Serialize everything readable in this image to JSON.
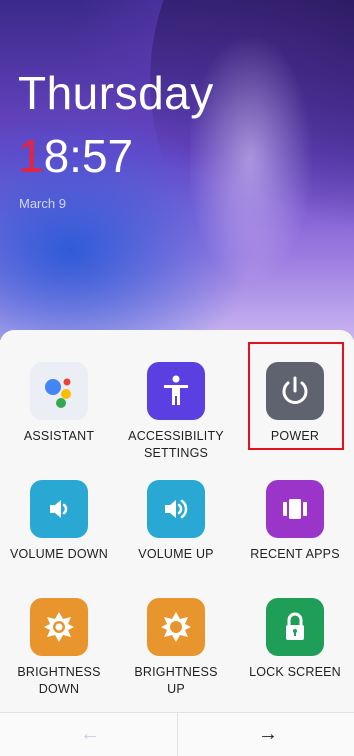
{
  "lockscreen": {
    "day": "Thursday",
    "time_first_digit": "1",
    "time_rest": "8:57",
    "date": "March 9"
  },
  "menu": {
    "items": [
      {
        "label": "ASSISTANT",
        "icon": "google-assistant-icon"
      },
      {
        "label": "ACCESSIBILITY\nSETTINGS",
        "icon": "accessibility-person-icon"
      },
      {
        "label": "POWER",
        "icon": "power-icon"
      },
      {
        "label": "VOLUME DOWN",
        "icon": "volume-down-icon"
      },
      {
        "label": "VOLUME UP",
        "icon": "volume-up-icon"
      },
      {
        "label": "RECENT APPS",
        "icon": "recent-apps-icon"
      },
      {
        "label": "BRIGHTNESS\nDOWN",
        "icon": "brightness-down-icon"
      },
      {
        "label": "BRIGHTNESS\nUP",
        "icon": "brightness-up-icon"
      },
      {
        "label": "LOCK SCREEN",
        "icon": "lock-icon"
      }
    ]
  },
  "nav": {
    "prev": "←",
    "next": "→"
  },
  "colors": {
    "accessibility": "#5b3fe0",
    "power": "#5f6370",
    "volume": "#2aa8d4",
    "recent": "#9b34c9",
    "brightness": "#e8952e",
    "lock": "#1e9e57",
    "highlight": "#e2121f"
  }
}
